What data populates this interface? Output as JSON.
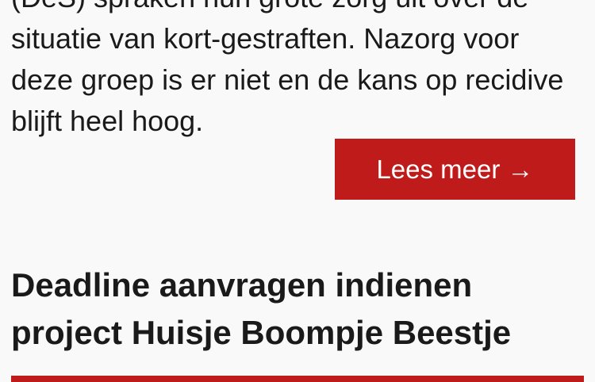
{
  "post1": {
    "excerpt_lines": [
      "(DeS) spraken hun grote zorg uit over de",
      "situatie van kort-gestraften. Nazorg voor",
      "deze groep is er niet en de kans op recidive",
      "blijft heel hoog."
    ],
    "read_more_label": "Lees meer →"
  },
  "post2": {
    "title_lines": [
      "Deadline aanvragen indienen",
      "project Huisje Boompje Beestje"
    ]
  },
  "colors": {
    "accent": "#bf1b1b",
    "text": "#1a1a1a",
    "background": "#f9f9f9"
  }
}
